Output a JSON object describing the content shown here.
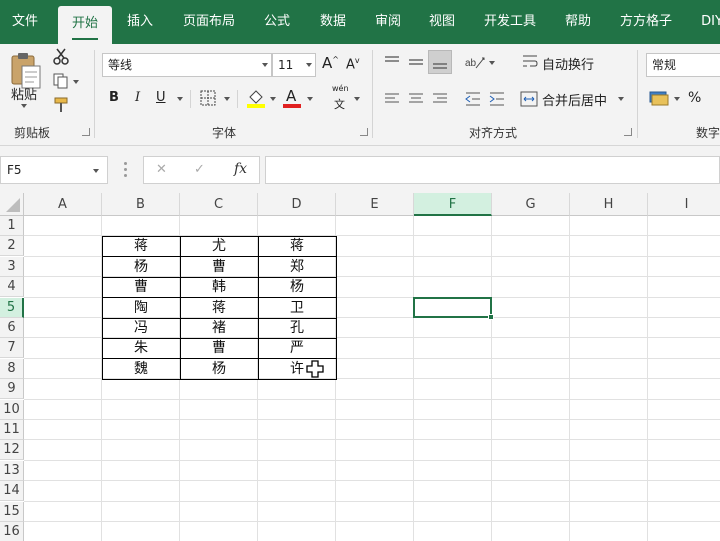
{
  "tabs": [
    {
      "label": "文件",
      "active": false
    },
    {
      "label": "开始",
      "active": true
    },
    {
      "label": "插入",
      "active": false
    },
    {
      "label": "页面布局",
      "active": false
    },
    {
      "label": "公式",
      "active": false
    },
    {
      "label": "数据",
      "active": false
    },
    {
      "label": "审阅",
      "active": false
    },
    {
      "label": "视图",
      "active": false
    },
    {
      "label": "开发工具",
      "active": false
    },
    {
      "label": "帮助",
      "active": false
    },
    {
      "label": "方方格子",
      "active": false
    },
    {
      "label": "DIY",
      "active": false
    }
  ],
  "ribbon": {
    "clipboard": {
      "paste_label": "粘贴",
      "group_label": "剪贴板"
    },
    "font": {
      "font_name": "等线",
      "font_size": "11",
      "bold": "B",
      "italic": "I",
      "underline": "U",
      "grow": "A",
      "shrink": "A",
      "font_color_letter": "A",
      "phonetic": "wén",
      "phonetic_char": "文",
      "group_label": "字体"
    },
    "alignment": {
      "wrap_text": "自动换行",
      "merge_center": "合并后居中",
      "group_label": "对齐方式"
    },
    "number": {
      "format": "常规",
      "percent": "%",
      "group_label": "数字"
    }
  },
  "formula_bar": {
    "name_box": "F5",
    "cancel": "✕",
    "enter": "✓",
    "fx": "fx",
    "formula": ""
  },
  "columns": [
    "A",
    "B",
    "C",
    "D",
    "E",
    "F",
    "G",
    "H",
    "I"
  ],
  "rows": [
    "1",
    "2",
    "3",
    "4",
    "5",
    "6",
    "7",
    "8",
    "9",
    "10",
    "11",
    "12",
    "13",
    "14",
    "15",
    "16"
  ],
  "table": {
    "B": [
      "蒋",
      "杨",
      "曹",
      "陶",
      "冯",
      "朱",
      "魏"
    ],
    "C": [
      "尤",
      "曹",
      "韩",
      "蒋",
      "褚",
      "曹",
      "杨"
    ],
    "D": [
      "蒋",
      "郑",
      "杨",
      "卫",
      "孔",
      "严",
      "许"
    ]
  },
  "selection": {
    "cell": "F5",
    "column": "F",
    "row": "5"
  },
  "colors": {
    "accent": "#217346",
    "ribbon_bg": "#f3f3f3",
    "selected_header": "#d3f0e0"
  }
}
